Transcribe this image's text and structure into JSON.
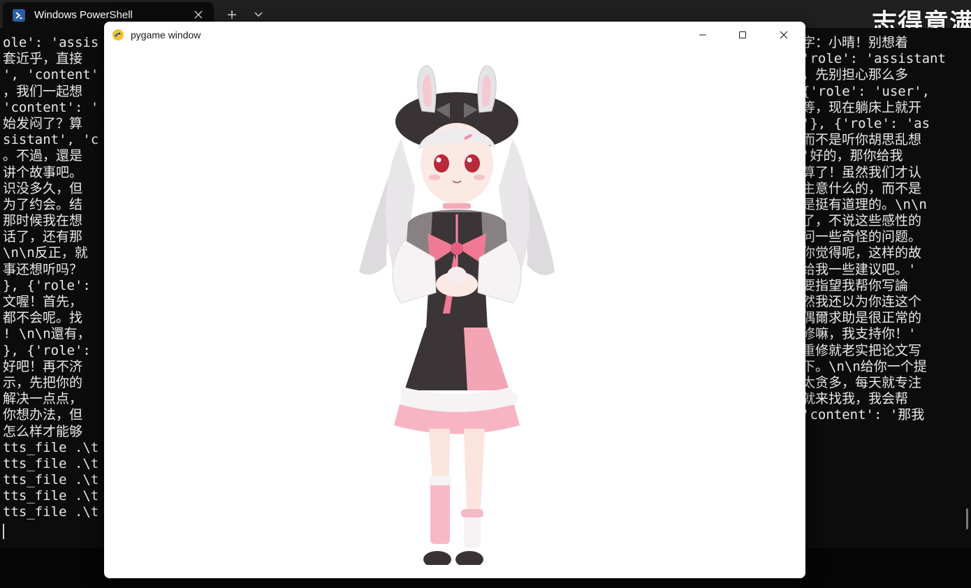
{
  "terminal": {
    "tab_title": "Windows PowerShell",
    "tab_icon": "powershell-icon",
    "watermark": "_志得意满",
    "left_lines": [
      "ole': 'assis",
      "套近乎，直接",
      "', 'content'",
      "，我们一起想",
      "'content': '",
      "始发闷了？算",
      "sistant', 'c",
      "。不過，還是",
      "讲个故事吧。",
      "识没多久，但",
      "为了约会。结",
      "那时候我在想",
      "话了，还有那",
      "\\n\\n反正，就",
      "事还想听吗？",
      "}, {'role':",
      "文喔！首先，",
      "都不会呢。找",
      "! \\n\\n還有，",
      "}, {'role':",
      "好吧！再不济",
      "示，先把你的",
      "解决一点点，",
      "你想办法，但",
      "怎么样才能够",
      "tts_file .\\t",
      "tts_file .\\t",
      "tts_file .\\t",
      "tts_file .\\t",
      "tts_file .\\t"
    ],
    "right_lines": [
      "字：小晴！别想着",
      "'role': 'assistant",
      "，先别担心那么多",
      "{'role': 'user',",
      "等，现在躺床上就开",
      "'}, {'role': 'as",
      "而不是听你胡思乱想",
      "'好的，那你给我",
      "算了！虽然我们才认",
      "主意什么的，而不是",
      "是挺有道理的。\\n\\n",
      "了，不说这些感性的",
      "问一些奇怪的问题。",
      "你觉得呢，这样的故",
      "给我一些建议吧。'",
      "要指望我帮你写論",
      "然我还以为你连这个",
      "偶爾求助是很正常的",
      "修嘛，我支持你！'",
      "重修就老实把论文写",
      "下。\\n\\n给你一个提",
      "太贪多，每天就专注",
      "就来找我，我会帮",
      "'content': '那我",
      "",
      "",
      "",
      "",
      "",
      ""
    ]
  },
  "pygame": {
    "title": "pygame window",
    "icon": "pygame-snake-icon"
  },
  "colors": {
    "terminal_bg": "#0c0c0c",
    "tab_strip": "#202020",
    "terminal_text": "#e8e8e8",
    "window_bg": "#ffffff",
    "accent_pink": "#f28ea3",
    "hair": "#e4e1e4"
  }
}
